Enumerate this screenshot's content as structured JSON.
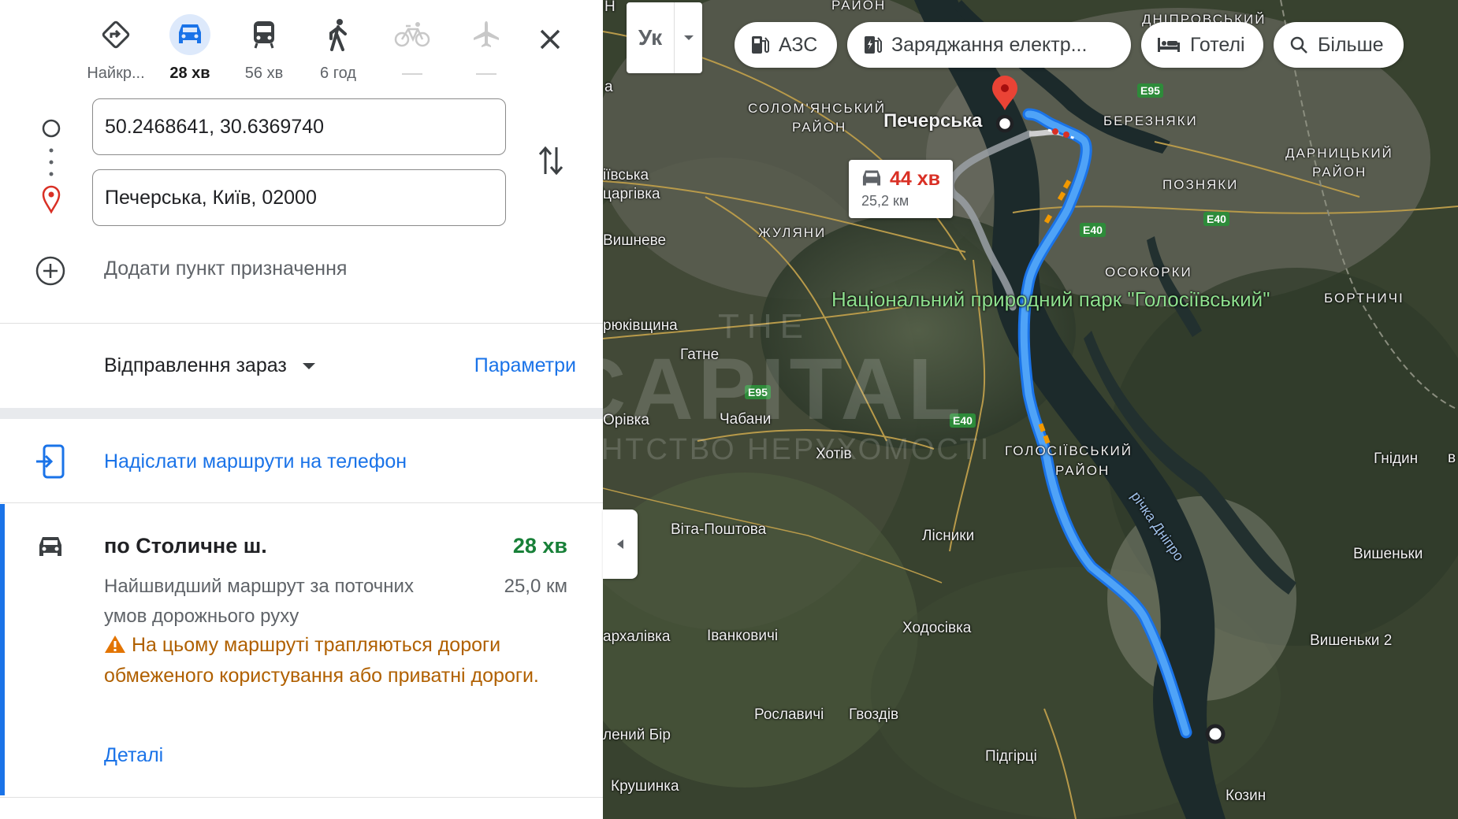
{
  "panel": {
    "modes": [
      {
        "icon": "directions-icon",
        "label": "Найкр...",
        "selected": false
      },
      {
        "icon": "car-icon",
        "label": "28 хв",
        "selected": true
      },
      {
        "icon": "transit-icon",
        "label": "56 хв",
        "selected": false
      },
      {
        "icon": "walk-icon",
        "label": "6 год",
        "selected": false
      },
      {
        "icon": "bicycle-icon",
        "label": "",
        "selected": false
      },
      {
        "icon": "flight-icon",
        "label": "",
        "selected": false
      }
    ],
    "origin": "50.2468641, 30.6369740",
    "destination": "Печерська, Київ, 02000",
    "add_destination": "Додати пункт призначення",
    "depart_label": "Відправлення зараз",
    "options_label": "Параметри",
    "send_label": "Надіслати маршрути на телефон",
    "route": {
      "title": "по Столичне ш.",
      "duration": "28 хв",
      "description": "Найшвидший маршрут за поточних умов дорожнього руху",
      "distance": "25,0 км",
      "warning": "На цьому маршруті трапляються дороги обмеженого користування або приватні дороги.",
      "details_label": "Деталі"
    }
  },
  "map": {
    "layer_label": "Ук",
    "chips": {
      "gas": "АЗС",
      "charging": "Заряджання електр...",
      "hotels": "Готелі",
      "more": "Більше"
    },
    "alt_route": {
      "duration": "44 хв",
      "distance": "25,2 км"
    },
    "destination_label": "Печерська",
    "labels": {
      "solomianskyi": "СОЛОМ'ЯНСЬКИЙ",
      "raion": "РАЙОН",
      "bereznyaky": "БЕРЕЗНЯКИ",
      "darnytskyi": "ДАРНИЦЬКИЙ",
      "pozniaky": "ПОЗНЯКИ",
      "osokorky": "ОСОКОРКИ",
      "bortnychi": "БОРТНИЧІ",
      "zhuliany": "ЖУЛЯНИ",
      "holosiivskyi": "ГОЛОСІЇВСЬКИЙ",
      "dniprovskyi": "ДНІПРОВСЬКИЙ",
      "vyshneve": "Вишневе",
      "hatne": "Гатне",
      "chabany": "Чабани",
      "khotiv": "Хотів",
      "vita_poshtova": "Віта-Поштова",
      "lisnyky": "Лісники",
      "khodosivka": "Ходосівка",
      "ivankovychi": "Іванковичі",
      "roslavychi": "Рославичі",
      "hvozdiv": "Гвоздів",
      "pidhirtsi": "Підгірці",
      "kozyn": "Козин",
      "vyshenky": "Вишеньки",
      "vyshenky2": "Вишеньки 2",
      "hnidyn": "Гнідин",
      "krushynka": "Крушинка",
      "orivka": "Орівка",
      "kriukivshchyna": "рюківщина",
      "arkhalivka": "архалівка",
      "lenyi_bir": "лений Бір",
      "tsarhivka": "царгівка",
      "ivska": "іївська",
      "park": "Національний природний парк \"Голосіївський\"",
      "river": "річка Дніпро",
      "e95": "E95",
      "e40": "E40",
      "letter_h": "Н",
      "edge_v": "в",
      "edge_a": "а"
    },
    "watermark_line1": "THE",
    "watermark_line2": "CAPITAL",
    "watermark_line3": "АГЕНТСТВО НЕРУХОМОСТІ"
  }
}
